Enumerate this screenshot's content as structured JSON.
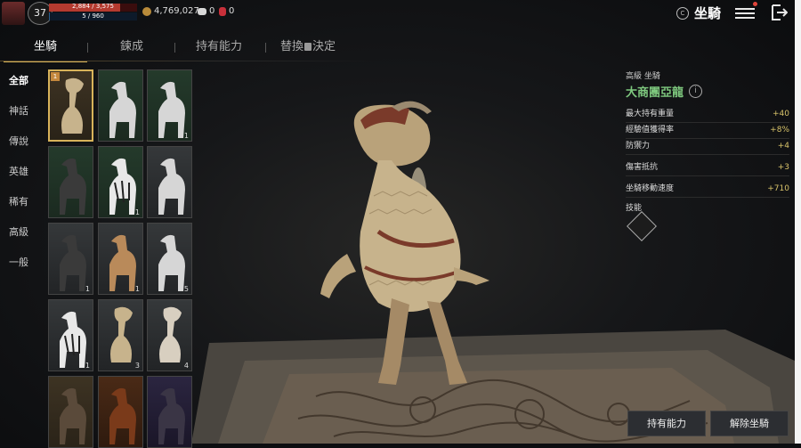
{
  "header": {
    "level": "37",
    "hp": "2,884 / 3,575",
    "mp": "5 / 960",
    "hp_fraction": 0.81,
    "mp_fraction": 0.01,
    "gold": "4,769,027",
    "gems": "0",
    "rubies": "0",
    "title": "坐騎",
    "title_badge": "C"
  },
  "tabs": [
    {
      "label": "坐騎",
      "active": true
    },
    {
      "label": "鍊成",
      "active": false
    },
    {
      "label": "持有能力",
      "active": false
    },
    {
      "label": "替換",
      "label2": "決定",
      "active": false
    }
  ],
  "categories": [
    "全部",
    "神話",
    "傳說",
    "英雄",
    "稀有",
    "高級",
    "一般"
  ],
  "mounts": [
    {
      "badge": "1",
      "num": "",
      "bg": "g-gold",
      "kind": "dino"
    },
    {
      "num": "",
      "bg": "g-green",
      "kind": "horse-white"
    },
    {
      "num": "1",
      "bg": "g-green",
      "kind": "horse-white"
    },
    {
      "num": "",
      "bg": "g-green",
      "kind": "horse-black"
    },
    {
      "num": "1",
      "bg": "g-green",
      "kind": "zebra"
    },
    {
      "num": "",
      "bg": "g-gray",
      "kind": "horse-white"
    },
    {
      "num": "1",
      "bg": "g-gray",
      "kind": "horse-black"
    },
    {
      "num": "1",
      "bg": "g-gray",
      "kind": "horse-brown"
    },
    {
      "num": "5",
      "bg": "g-gray",
      "kind": "horse-white"
    },
    {
      "num": "1",
      "bg": "g-gray",
      "kind": "zebra"
    },
    {
      "num": "3",
      "bg": "g-gray",
      "kind": "dino"
    },
    {
      "num": "4",
      "bg": "g-gray",
      "kind": "dino-white"
    },
    {
      "num": "",
      "bg": "g-gold",
      "kind": "beast"
    },
    {
      "num": "",
      "bg": "g-orange",
      "kind": "beast-red"
    },
    {
      "num": "",
      "bg": "g-purple",
      "kind": "beast-dark"
    }
  ],
  "detail": {
    "rarity": "高級 坐騎",
    "name": "大商團亞龍",
    "info_icon": "i",
    "stats": [
      {
        "label": "最大持有重量",
        "value": "+40"
      },
      {
        "label": "經驗值獲得率",
        "value": "+8%"
      },
      {
        "label": "防禦力",
        "value": "+4"
      },
      {
        "label": "傷害抵抗",
        "value": "+3"
      },
      {
        "label": "坐騎移動速度",
        "value": "+710"
      }
    ],
    "skills_label": "技能"
  },
  "buttons": {
    "abilities": "持有能力",
    "dismount": "解除坐騎"
  },
  "colors": {
    "accent": "#d8b35a",
    "name_green": "#7ec87e",
    "stat_value": "#d8c36a",
    "hp": "#b43a2f",
    "mp": "#2a5d8a"
  }
}
